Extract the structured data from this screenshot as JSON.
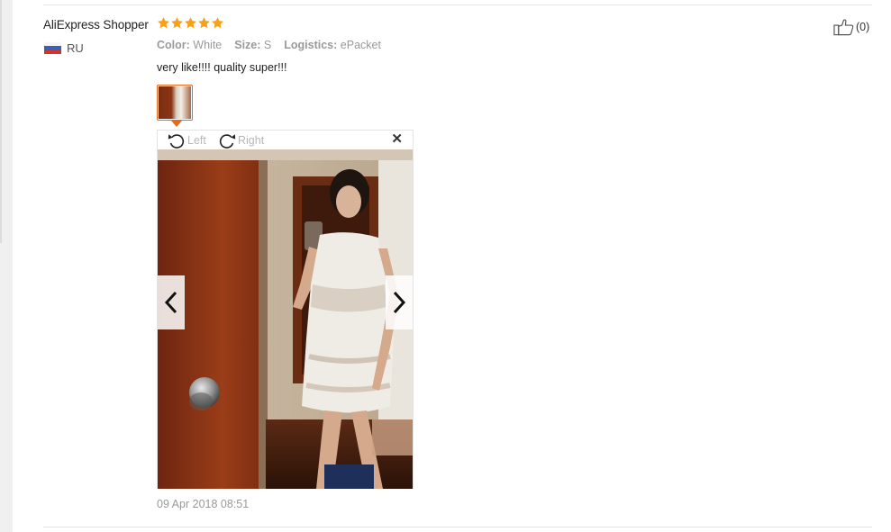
{
  "review": {
    "user_name": "AliExpress Shopper",
    "rating": 5,
    "country_code": "RU",
    "attributes": [
      {
        "key": "Color:",
        "value": "White"
      },
      {
        "key": "Size:",
        "value": "S"
      },
      {
        "key": "Logistics:",
        "value": "ePacket"
      }
    ],
    "text": "very like!!!! quality super!!!",
    "date": "09 Apr 2018 08:51",
    "helpful_count": "(0)"
  },
  "viewer": {
    "rotate_left_label": "Left",
    "rotate_right_label": "Right",
    "close_glyph": "✕"
  },
  "colors": {
    "star": "#f7a11a",
    "accent": "#e86a1c",
    "muted_text": "#999999"
  },
  "icons": {
    "star": "star-icon",
    "flag": "russia-flag-icon",
    "thumbs_up": "thumbs-up-icon",
    "rotate_left": "rotate-left-icon",
    "rotate_right": "rotate-right-icon",
    "prev": "chevron-left-icon",
    "next": "chevron-right-icon",
    "close": "close-icon"
  }
}
